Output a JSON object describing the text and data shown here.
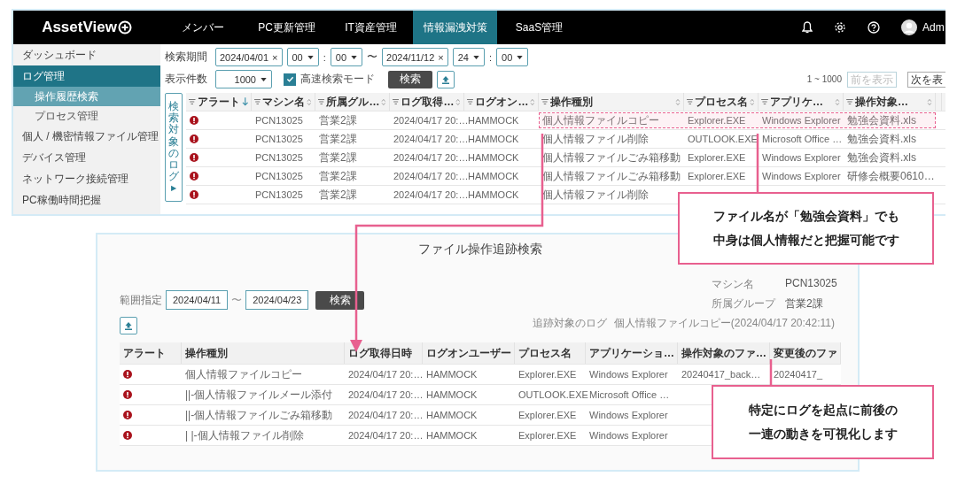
{
  "app": {
    "logo": "AssetView",
    "nav": [
      {
        "label": "メンバー",
        "selected": false
      },
      {
        "label": "PC更新管理",
        "selected": false
      },
      {
        "label": "IT資産管理",
        "selected": false
      },
      {
        "label": "情報漏洩対策",
        "selected": true
      },
      {
        "label": "SaaS管理",
        "selected": false
      }
    ],
    "user": "Adm",
    "sidebar": {
      "items": [
        {
          "label": "ダッシュボード",
          "selected": false
        },
        {
          "label": "ログ管理",
          "selected": true,
          "children": [
            {
              "label": "操作履歴検索",
              "selected": true
            },
            {
              "label": "プロセス管理",
              "selected": false
            }
          ]
        },
        {
          "label": "個人 / 機密情報ファイル管理",
          "selected": false
        },
        {
          "label": "デバイス管理",
          "selected": false
        },
        {
          "label": "ネットワーク接続管理",
          "selected": false
        },
        {
          "label": "PC稼働時間把握",
          "selected": false
        }
      ]
    },
    "search": {
      "period_label": "検索期間",
      "start": {
        "date": "2024/04/01",
        "clear": "×",
        "hour": "00",
        "time_sep": ":",
        "minute": "00"
      },
      "range_sep": "〜",
      "end": {
        "date": "2024/11/12",
        "clear": "×",
        "hour": "24",
        "time_sep": ":",
        "minute": "00"
      },
      "count_label": "表示件数",
      "count": "1000",
      "fast_mode": {
        "label": "高速検索モード",
        "checked": true
      },
      "search_button": "検索",
      "range": "1 ~ 1000",
      "prev": {
        "label": "前を表示",
        "disabled": true
      },
      "next": {
        "label": "次を表",
        "disabled": false
      }
    },
    "side_tab": {
      "label": "検索対象のログ",
      "arrow": "▶"
    },
    "table": {
      "alert_column": {
        "label": "アラート",
        "sorted": true
      },
      "columns": [
        {
          "label": "マシン名",
          "sorted": false
        },
        {
          "label": "所属グル…",
          "sorted": false
        },
        {
          "label": "ログ取得…",
          "sorted": false
        },
        {
          "label": "ログオン…",
          "sorted": false
        },
        {
          "label": "操作種別",
          "sorted": false
        },
        {
          "label": "プロセス名",
          "sorted": false
        },
        {
          "label": "アプリケ…",
          "sorted": false
        },
        {
          "label": "操作対象…",
          "sorted": false
        }
      ],
      "rows": [
        {
          "alert": true,
          "highlighted": true,
          "cells": [
            "PCN13025",
            "営業2課",
            "2024/04/17 20:…",
            "HAMMOCK",
            "個人情報ファイルコピー",
            "Explorer.EXE",
            "Windows Explorer",
            "勉強会資料.xls"
          ]
        },
        {
          "alert": true,
          "highlighted": false,
          "cells": [
            "PCN13025",
            "営業2課",
            "2024/04/17 20:…",
            "HAMMOCK",
            "個人情報ファイル削除",
            "OUTLOOK.EXE",
            "Microsoft Office …",
            "勉強会資料.xls"
          ]
        },
        {
          "alert": true,
          "highlighted": false,
          "cells": [
            "PCN13025",
            "営業2課",
            "2024/04/17 20:…",
            "HAMMOCK",
            "個人情報ファイルごみ箱移動",
            "Explorer.EXE",
            "Windows Explorer",
            "勉強会資料.xls"
          ]
        },
        {
          "alert": true,
          "highlighted": false,
          "cells": [
            "PCN13025",
            "営業2課",
            "2024/04/17 20:…",
            "HAMMOCK",
            "個人情報ファイルごみ箱移動",
            "Explorer.EXE",
            "Windows Explorer",
            "研修会概要0610…"
          ]
        },
        {
          "alert": true,
          "highlighted": false,
          "cells": [
            "PCN13025",
            "営業2課",
            "2024/04/17 20:…",
            "HAMMOCK",
            "個人情報ファイル削除"
          ]
        }
      ]
    }
  },
  "trace": {
    "title": "ファイル操作追跡検索",
    "range_label": "範囲指定",
    "from": "2024/04/11",
    "sep": "〜",
    "to": "2024/04/23",
    "search_button": "検索",
    "info": [
      {
        "label": "マシン名",
        "value": "PCN13025"
      },
      {
        "label": "所属グループ",
        "value": "営業2課"
      }
    ],
    "target": {
      "label": "追跡対象のログ",
      "value": "個人情報ファイルコピー(2024/04/17 20:42:11)"
    },
    "table": {
      "alert_column": "アラート",
      "columns": [
        "操作種別",
        "ログ取得日時",
        "ログオンユーザー",
        "プロセス名",
        "アプリケーショ…",
        "操作対象のファ…",
        "変更後のファ"
      ],
      "rows": [
        {
          "alert": true,
          "cells": [
            "個人情報ファイルコピー",
            "2024/04/17 20:…",
            "HAMMOCK",
            "Explorer.EXE",
            "Windows Explorer",
            "20240417_back…",
            "20240417_"
          ]
        },
        {
          "alert": true,
          "cells": [
            "||-個人情報ファイルメール添付",
            "2024/04/17 20:…",
            "HAMMOCK",
            "OUTLOOK.EXE",
            "Microsoft Office …"
          ]
        },
        {
          "alert": true,
          "cells": [
            "||-個人情報ファイルごみ箱移動",
            "2024/04/17 20:…",
            "HAMMOCK",
            "Explorer.EXE",
            "Windows Explorer"
          ]
        },
        {
          "alert": true,
          "cells": [
            "| |-個人情報ファイル削除",
            "2024/04/17 20:…",
            "HAMMOCK",
            "Explorer.EXE",
            "Windows Explorer"
          ]
        }
      ]
    }
  },
  "callouts": [
    {
      "lines": [
        "ファイル名が「勉強会資料」でも",
        "中身は個人情報だと把握可能です"
      ]
    },
    {
      "lines": [
        "特定にログを起点に前後の",
        "一連の動きを可視化します"
      ]
    }
  ]
}
